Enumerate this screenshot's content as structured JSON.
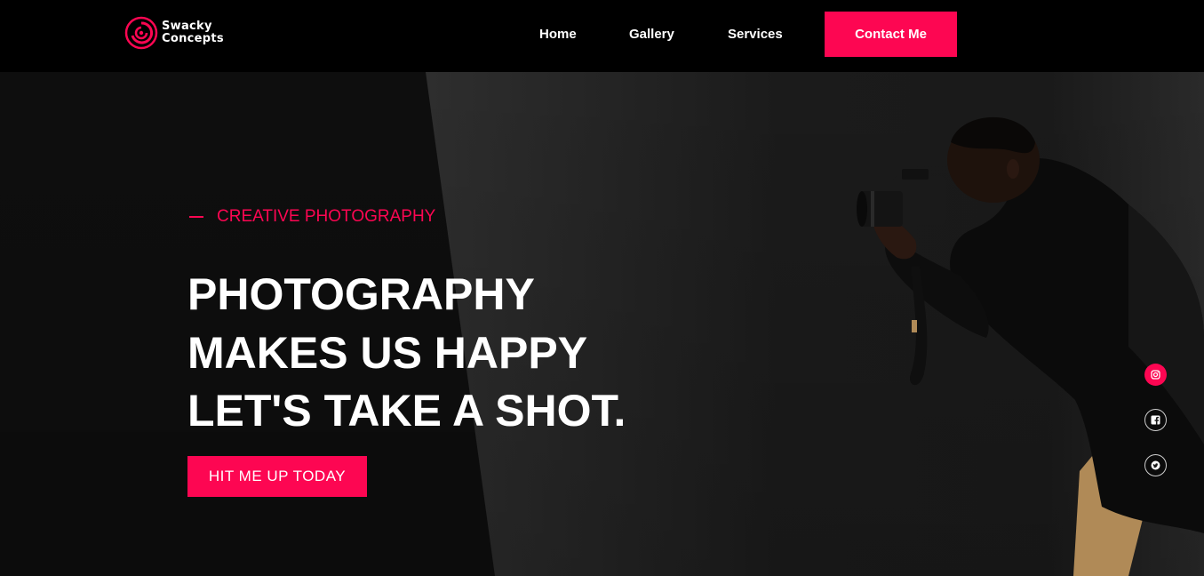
{
  "brand": {
    "name_line1": "Swacky",
    "name_line2": "Concepts",
    "accent": "#fd0652"
  },
  "nav": {
    "items": [
      {
        "label": "Home"
      },
      {
        "label": "Gallery"
      },
      {
        "label": "Services"
      }
    ],
    "contact_label": "Contact Me"
  },
  "hero": {
    "eyebrow": "CREATIVE PHOTOGRAPHY",
    "headline_line1": "PHOTOGRAPHY",
    "headline_line2": "MAKES US HAPPY",
    "headline_line3": "LET'S TAKE A SHOT.",
    "cta_label": "HIT ME UP TODAY"
  },
  "social": [
    {
      "icon": "instagram-icon"
    },
    {
      "icon": "facebook-icon"
    },
    {
      "icon": "twitter-icon"
    }
  ]
}
